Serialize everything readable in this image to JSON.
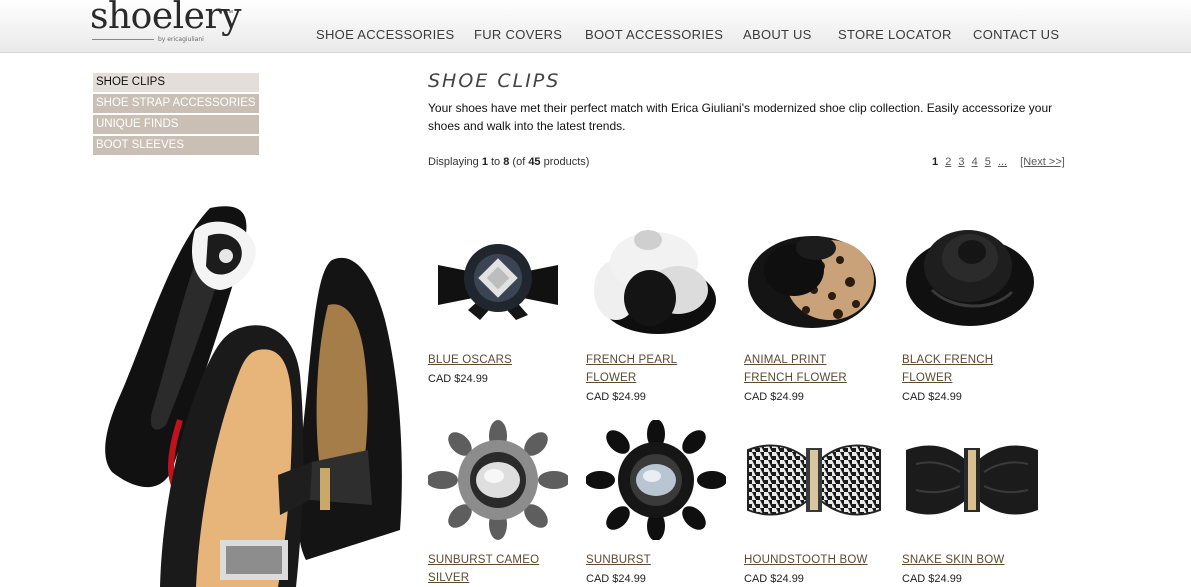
{
  "header": {
    "logo_text": "shoelery",
    "logo_tm": "™",
    "logo_sub": "by ericagiuliani",
    "nav": [
      {
        "label": "SHOE ACCESSORIES"
      },
      {
        "label": "FUR COVERS"
      },
      {
        "label": "BOOT ACCESSORIES"
      },
      {
        "label": "ABOUT US"
      },
      {
        "label": "STORE LOCATOR"
      },
      {
        "label": "CONTACT US"
      }
    ]
  },
  "sidebar": {
    "items": [
      {
        "label": "SHOE CLIPS",
        "active": true
      },
      {
        "label": "SHOE STRAP ACCESSORIES",
        "active": false
      },
      {
        "label": "UNIQUE FINDS",
        "active": false
      },
      {
        "label": "BOOT SLEEVES",
        "active": false
      }
    ]
  },
  "main": {
    "title": "SHOE CLIPS",
    "description": "Your shoes have met their perfect match with Erica Giuliani's modernized shoe clip collection. Easily accessorize your shoes and walk into the latest trends.",
    "count": {
      "prefix": "Displaying ",
      "from": "1",
      "to_word": " to ",
      "to": "8",
      "of_prefix": " (of ",
      "total": "45",
      "suffix": " products)"
    },
    "pager": {
      "current": "1",
      "pages": [
        "2",
        "3",
        "4",
        "5",
        "..."
      ],
      "next": "[Next >>]"
    }
  },
  "products": [
    {
      "name_lines": [
        "BLUE OSCARS"
      ],
      "price": "CAD $24.99",
      "icon": "jeweled-bow-clip-icon"
    },
    {
      "name_lines": [
        "FRENCH PEARL",
        "FLOWER"
      ],
      "price": "CAD $24.99",
      "icon": "black-white-camellia-clip-icon"
    },
    {
      "name_lines": [
        "ANIMAL PRINT",
        "FRENCH FLOWER"
      ],
      "price": "CAD $24.99",
      "icon": "leopard-flower-clip-icon"
    },
    {
      "name_lines": [
        "BLACK FRENCH",
        "FLOWER"
      ],
      "price": "CAD $24.99",
      "icon": "black-rose-clip-icon"
    },
    {
      "name_lines": [
        "SUNBURST CAMEO",
        "SILVER"
      ],
      "price": "",
      "icon": "silver-sunburst-clip-icon"
    },
    {
      "name_lines": [
        "SUNBURST"
      ],
      "price": "CAD $24.99",
      "icon": "black-sunburst-clip-icon"
    },
    {
      "name_lines": [
        "HOUNDSTOOTH BOW"
      ],
      "price": "CAD $24.99",
      "icon": "houndstooth-bow-clip-icon"
    },
    {
      "name_lines": [
        "SNAKE SKIN BOW"
      ],
      "price": "CAD $24.99",
      "icon": "snake-skin-bow-clip-icon"
    }
  ]
}
